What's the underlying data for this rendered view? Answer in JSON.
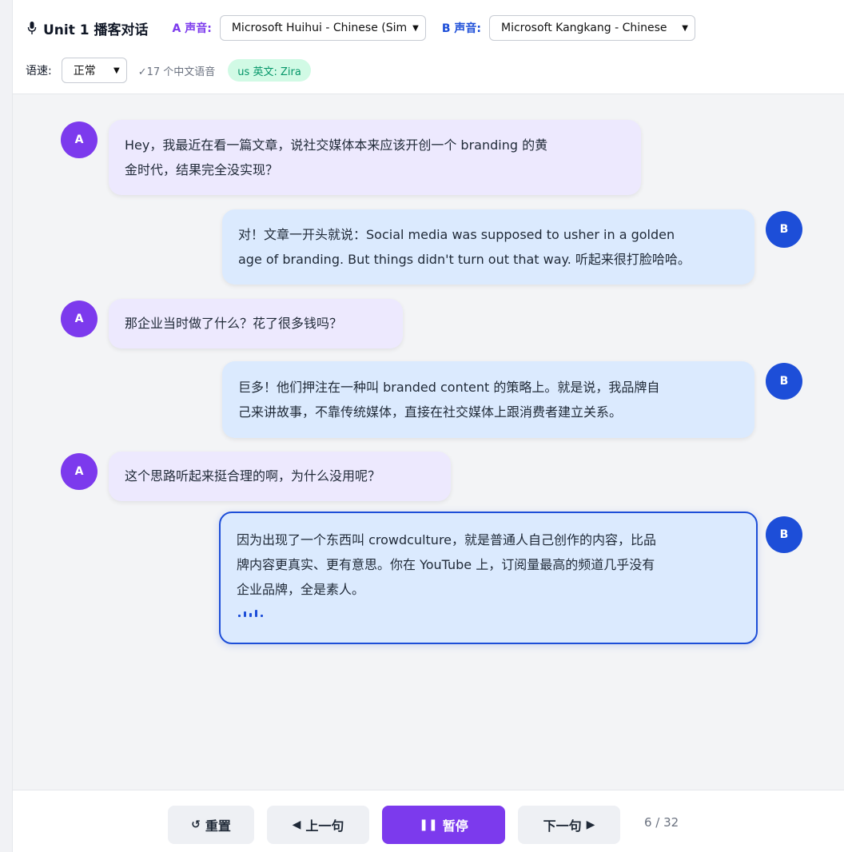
{
  "header": {
    "title": "Unit 1 播客对话",
    "voice_a_label": "A 声音:",
    "voice_a_value": "Microsoft Huihui - Chinese (Sim",
    "voice_b_label": "B 声音:",
    "voice_b_value": "Microsoft Kangkang - Chinese",
    "speed_label": "语速:",
    "speed_value": "正常",
    "voice_count": "✓17 个中文语音",
    "english_badge": "us 英文: Zira"
  },
  "messages": [
    {
      "speaker": "A",
      "lines": [
        "Hey，我最近在看一篇文章，说社交媒体本来应该开创一个 branding 的黄",
        "金时代，结果完全没实现？"
      ]
    },
    {
      "speaker": "B",
      "lines": [
        "对！文章一开头就说：Social media was supposed to usher in a golden",
        "age of branding. But things didn't turn out that way. 听起来很打脸哈哈。"
      ]
    },
    {
      "speaker": "A",
      "lines": [
        "那企业当时做了什么？花了很多钱吗？"
      ]
    },
    {
      "speaker": "B",
      "lines": [
        "巨多！他们押注在一种叫 branded content 的策略上。就是说，我品牌自",
        "己来讲故事，不靠传统媒体，直接在社交媒体上跟消费者建立关系。"
      ]
    },
    {
      "speaker": "A",
      "lines": [
        "这个思路听起来挺合理的啊，为什么没用呢？"
      ]
    },
    {
      "speaker": "B",
      "lines": [
        "因为出现了一个东西叫 crowdculture，就是普通人自己创作的内容，比品",
        "牌内容更真实、更有意思。你在 YouTube 上，订阅量最高的频道几乎没有",
        "企业品牌，全是素人。"
      ],
      "active": true
    }
  ],
  "footer": {
    "reset_label": "重置",
    "prev_label": "上一句",
    "pause_label": "暂停",
    "next_label": "下一句",
    "progress": "6 / 32"
  },
  "icons": {
    "title": "microphone-icon",
    "reset": "reset-icon",
    "prev": "triangle-left-icon",
    "pause": "pause-icon",
    "next": "triangle-right-icon",
    "speaking": "sound-wave-icon"
  },
  "colors": {
    "speaker_a": "#7c3aed",
    "speaker_b": "#1d4ed8",
    "bubble_a": "#ede9fe",
    "bubble_b": "#dbeafe",
    "primary_button": "#7c3aed",
    "badge_bg": "#d1fae5",
    "badge_text": "#059669"
  }
}
